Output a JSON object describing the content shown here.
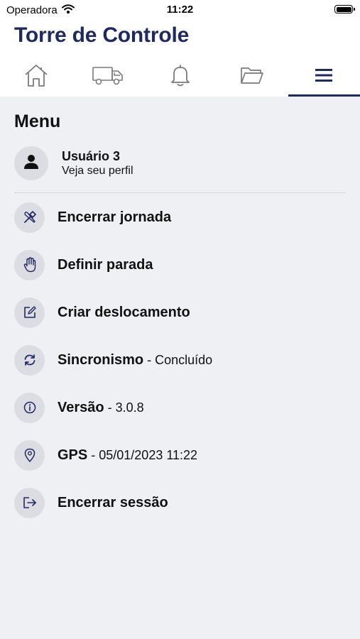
{
  "status_bar": {
    "carrier": "Operadora",
    "time": "11:22"
  },
  "app": {
    "title": "Torre de Controle"
  },
  "tabs": [
    {
      "icon": "home-icon",
      "active": false
    },
    {
      "icon": "truck-icon",
      "active": false
    },
    {
      "icon": "bell-icon",
      "active": false
    },
    {
      "icon": "folder-icon",
      "active": false
    },
    {
      "icon": "menu-icon",
      "active": true
    }
  ],
  "menu": {
    "title": "Menu",
    "profile": {
      "name": "Usuário 3",
      "subtitle": "Veja seu perfil",
      "icon": "person-icon"
    },
    "items": [
      {
        "label": "Encerrar jornada",
        "icon": "tools-icon"
      },
      {
        "label": "Definir parada",
        "icon": "hand-icon"
      },
      {
        "label": "Criar deslocamento",
        "icon": "edit-icon"
      },
      {
        "label": "Sincronismo",
        "separator": " - ",
        "detail": "Concluído",
        "icon": "sync-icon"
      },
      {
        "label": "Versão",
        "separator": " - ",
        "detail": "3.0.8",
        "icon": "info-icon"
      },
      {
        "label": "GPS",
        "separator": " - ",
        "detail": "05/01/2023 11:22",
        "icon": "location-pin-icon"
      },
      {
        "label": "Encerrar sessão",
        "icon": "logout-icon"
      }
    ]
  },
  "colors": {
    "brand": "#1f2a63",
    "background": "#eff0f4",
    "icon_circle": "#dcdde2"
  }
}
